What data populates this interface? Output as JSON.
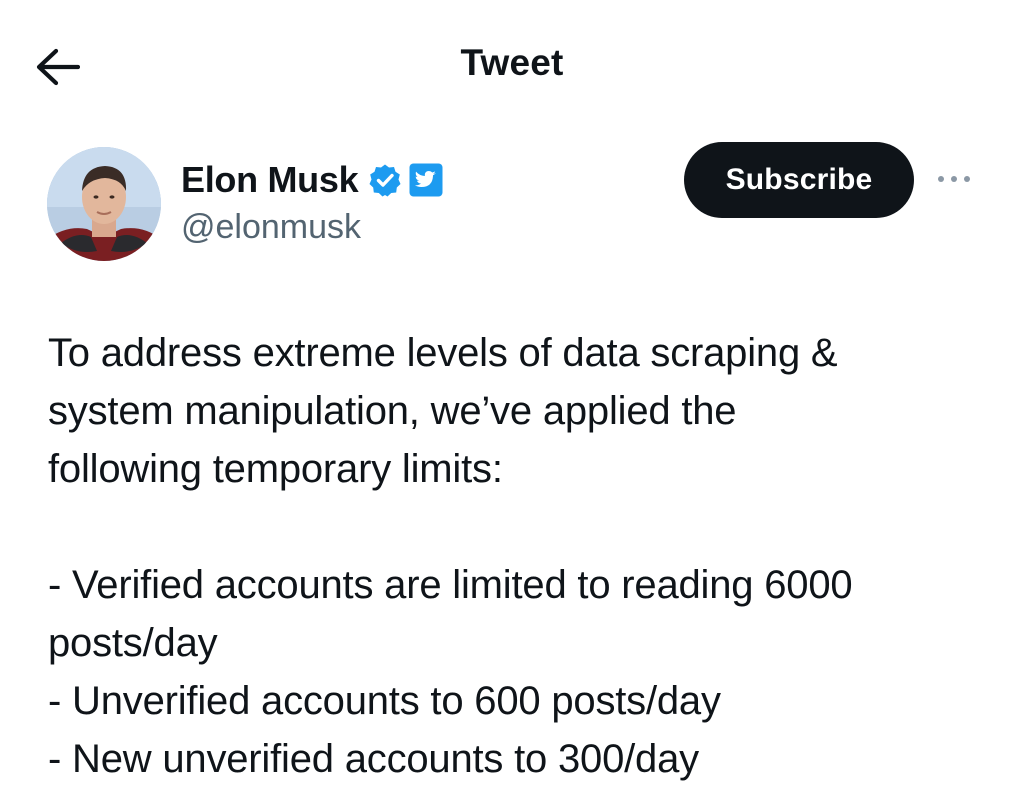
{
  "header": {
    "title": "Tweet",
    "back_icon": "arrow-left-icon"
  },
  "author": {
    "display_name": "Elon Musk",
    "handle": "@elonmusk",
    "verified_icon": "verified-badge-icon",
    "affiliate_icon": "twitter-bird-icon",
    "badge_color": "#1d9bf0"
  },
  "actions": {
    "subscribe_label": "Subscribe",
    "more_icon": "more-dots-icon"
  },
  "tweet": {
    "paragraph_lines": [
      "To address extreme levels of data scraping &",
      "system manipulation, we’ve applied the",
      "following temporary limits:"
    ],
    "limits_lines": [
      "- Verified accounts are limited to reading 6000",
      "posts/day",
      "- Unverified accounts to 600 posts/day",
      "- New unverified accounts to 300/day"
    ]
  },
  "colors": {
    "text": "#0f1419",
    "secondary_text": "#536471",
    "button_bg": "#0f1419",
    "accent": "#1d9bf0"
  }
}
